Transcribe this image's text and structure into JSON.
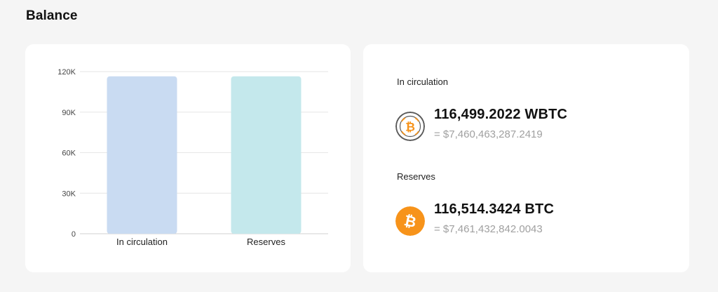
{
  "page": {
    "title": "Balance"
  },
  "chart_data": {
    "type": "bar",
    "categories": [
      "In circulation",
      "Reserves"
    ],
    "values": [
      116499.2022,
      116514.3424
    ],
    "ylim": [
      0,
      120000
    ],
    "yticks": [
      0,
      30000,
      60000,
      90000,
      120000
    ],
    "ytick_labels": [
      "0",
      "30K",
      "60K",
      "90K",
      "120K"
    ],
    "colors": [
      "#c9dbf2",
      "#c4e8ec"
    ],
    "grid": true,
    "title": "",
    "xlabel": "",
    "ylabel": ""
  },
  "info": {
    "in_circulation": {
      "label": "In circulation",
      "amount": "116,499.2022 WBTC",
      "usd": "= $7,460,463,287.2419",
      "icon": "wbtc-icon"
    },
    "reserves": {
      "label": "Reserves",
      "amount": "116,514.3424 BTC",
      "usd": "= $7,461,432,842.0043",
      "icon": "btc-icon"
    }
  },
  "colors": {
    "btc_orange": "#f7931a",
    "wbtc_ring": "#5a5a5a"
  }
}
